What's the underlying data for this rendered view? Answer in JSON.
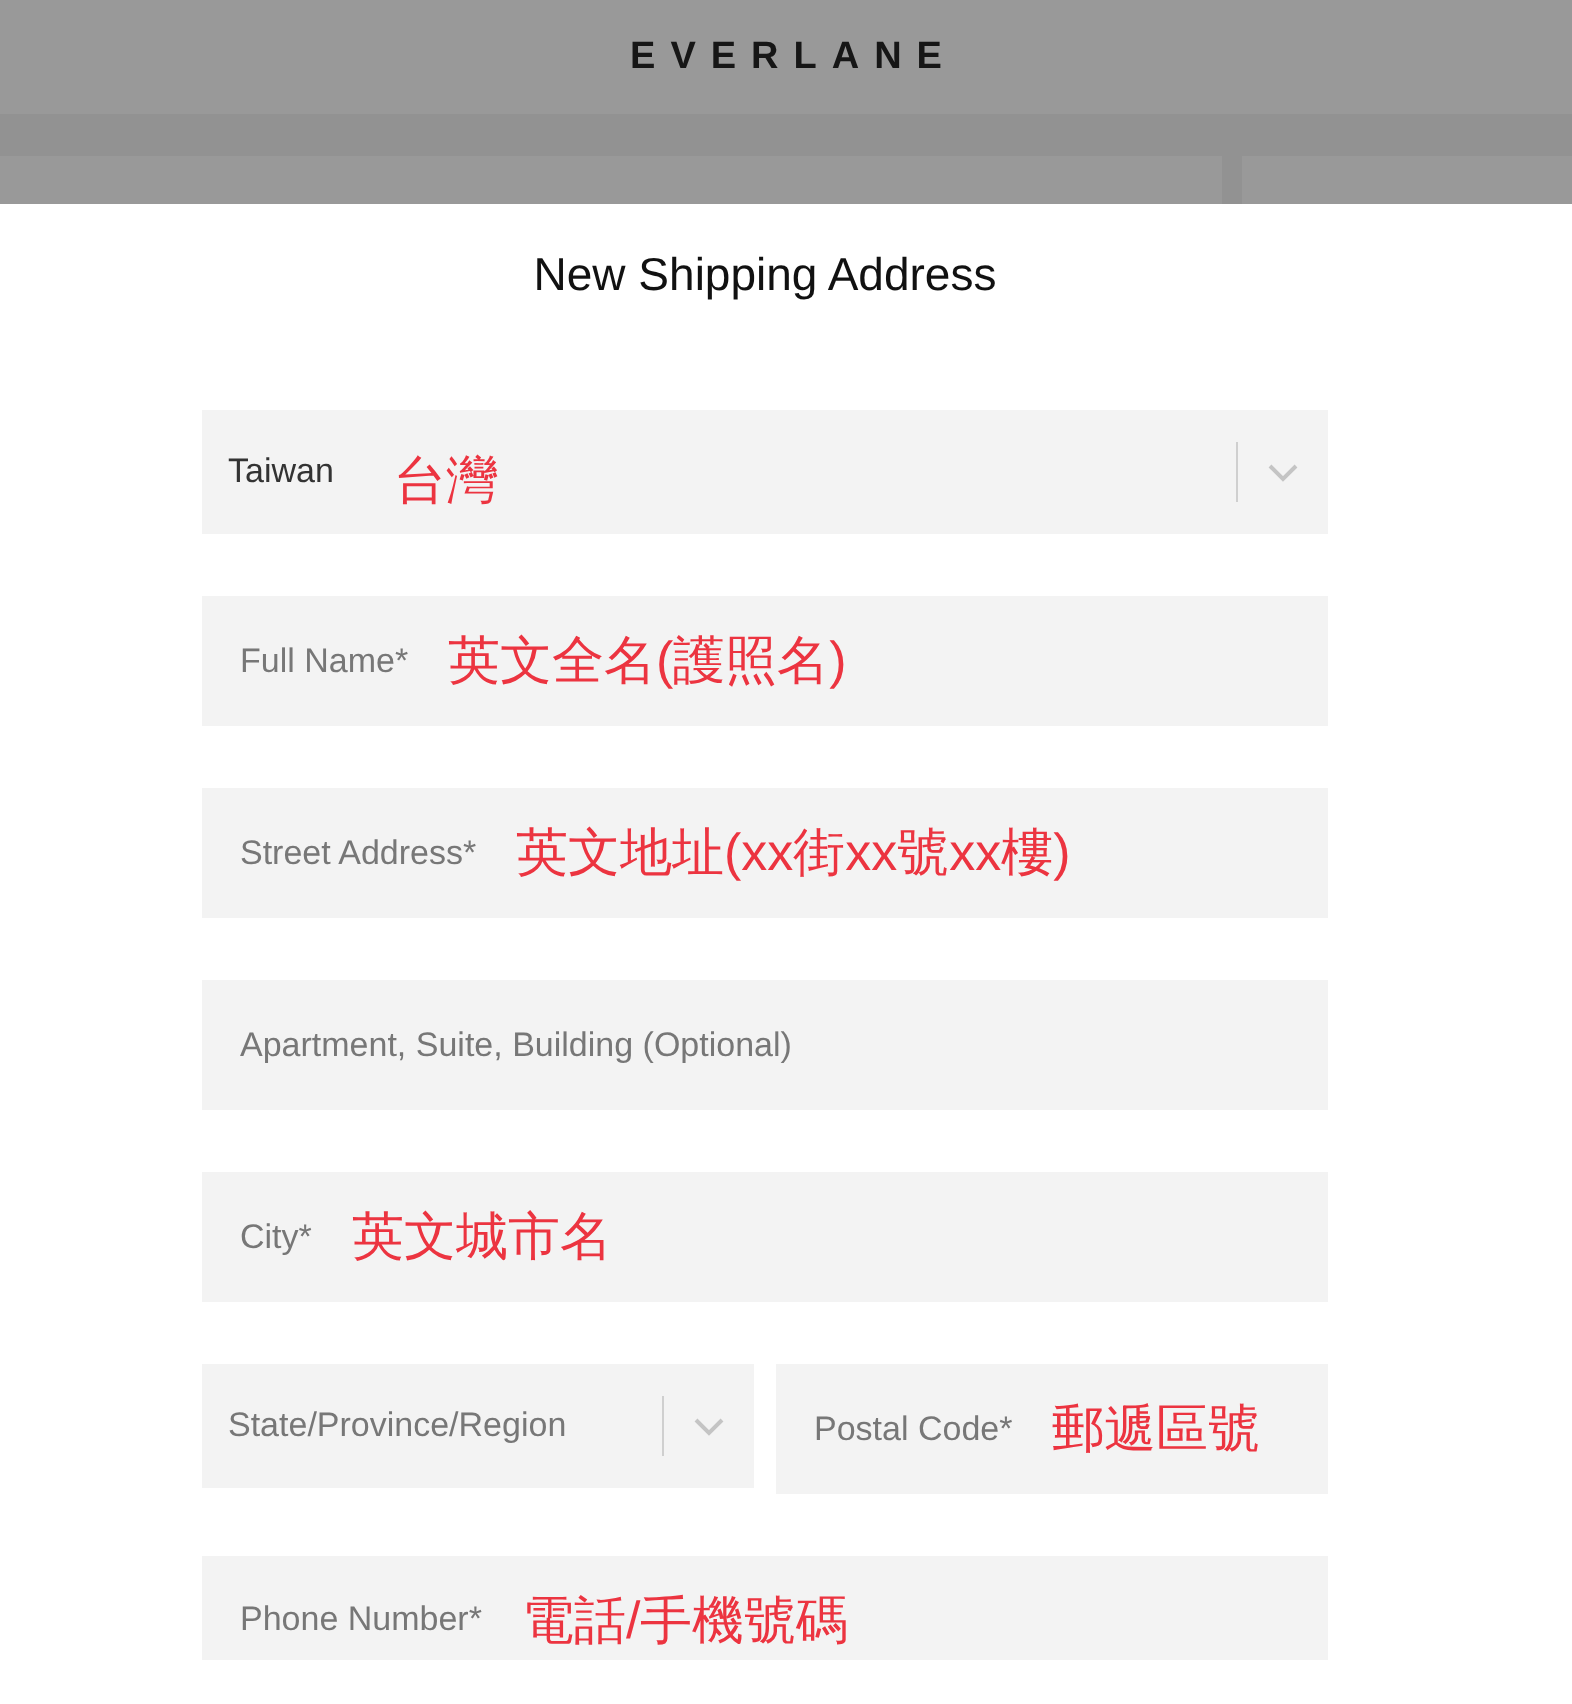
{
  "header": {
    "logo": "EVERLANE"
  },
  "dialog": {
    "title": "New Shipping Address",
    "fields": [
      {
        "kind": "select",
        "value": "Taiwan",
        "annotation": "台灣"
      },
      {
        "kind": "text",
        "placeholder": "Full Name*",
        "annotation": "英文全名(護照名)"
      },
      {
        "kind": "text",
        "placeholder": "Street Address*",
        "annotation": "英文地址(xx街xx號xx樓)"
      },
      {
        "kind": "text",
        "placeholder": "Apartment, Suite, Building (Optional)"
      },
      {
        "kind": "text",
        "placeholder": "City*",
        "annotation": "英文城市名"
      },
      {
        "kind": "pair",
        "items": [
          {
            "kind": "select",
            "placeholder": "State/Province/Region"
          },
          {
            "kind": "text",
            "placeholder": "Postal Code*",
            "annotation": "郵遞區號"
          }
        ]
      },
      {
        "kind": "text",
        "placeholder": "Phone Number*",
        "annotation": "電話/手機號碼"
      }
    ]
  }
}
